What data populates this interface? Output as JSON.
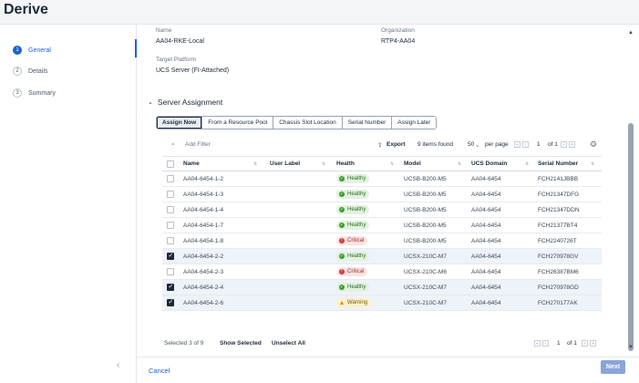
{
  "page": {
    "title": "Derive"
  },
  "steps": [
    {
      "num": "1",
      "label": "General"
    },
    {
      "num": "2",
      "label": "Details"
    },
    {
      "num": "3",
      "label": "Summary"
    }
  ],
  "general": {
    "name_label": "Name",
    "name_value": "AA04-RKE-Local",
    "org_label": "Organization",
    "org_value": "RTP4-AA04",
    "platform_label": "Target Platform",
    "platform_value": "UCS Server (FI-Attached)"
  },
  "section": {
    "title": "Server Assignment"
  },
  "tabs": [
    "Assign Now",
    "From a Resource Pool",
    "Chassis Slot Location",
    "Serial Number",
    "Assign Later"
  ],
  "toolbar": {
    "filter_placeholder": "Add Filter",
    "export_label": "Export",
    "items_found": "9 items found",
    "page_size": "50",
    "per_page": "per page",
    "page": "1",
    "of_pages": "of 1"
  },
  "table": {
    "columns": [
      "Name",
      "User Label",
      "Health",
      "Model",
      "UCS Domain",
      "Serial Number"
    ],
    "rows": [
      {
        "selected": false,
        "name": "AA04-6454-1-2",
        "health": "Healthy",
        "model": "UCSB-B200-M5",
        "domain": "AA04-6454",
        "serial": "FCH2141JBBB"
      },
      {
        "selected": false,
        "name": "AA04-6454-1-3",
        "health": "Healthy",
        "model": "UCSB-B200-M5",
        "domain": "AA04-6454",
        "serial": "FCH21347DFG"
      },
      {
        "selected": false,
        "name": "AA04-6454-1-4",
        "health": "Healthy",
        "model": "UCSB-B200-M5",
        "domain": "AA04-6454",
        "serial": "FCH21347DDN"
      },
      {
        "selected": false,
        "name": "AA04-6454-1-7",
        "health": "Healthy",
        "model": "UCSB-B200-M5",
        "domain": "AA04-6454",
        "serial": "FCH21377BT4"
      },
      {
        "selected": false,
        "name": "AA04-6454-1-8",
        "health": "Critical",
        "model": "UCSB-B200-M5",
        "domain": "AA04-6454",
        "serial": "FCH2240726T"
      },
      {
        "selected": true,
        "name": "AA04-6454-2-2",
        "health": "Healthy",
        "model": "UCSX-210C-M7",
        "domain": "AA04-6454",
        "serial": "FCH270978GV"
      },
      {
        "selected": false,
        "name": "AA04-6454-2-3",
        "health": "Critical",
        "model": "UCSX-210C-M6",
        "domain": "AA04-6454",
        "serial": "FCH26387BM6"
      },
      {
        "selected": true,
        "name": "AA04-6454-2-4",
        "health": "Healthy",
        "model": "UCSX-210C-M7",
        "domain": "AA04-6454",
        "serial": "FCH270978GD"
      },
      {
        "selected": true,
        "name": "AA04-6454-2-6",
        "health": "Warning",
        "model": "UCSX-210C-M7",
        "domain": "AA04-6454",
        "serial": "FCH270177AK"
      }
    ]
  },
  "footer": {
    "selected_text": "Selected 3 of 9",
    "show_selected": "Show Selected",
    "unselect_all": "Unselect All",
    "page": "1",
    "of_pages": "of 1"
  },
  "actions": {
    "cancel": "Cancel",
    "next": "Next"
  },
  "colors": {
    "accent": "#1d63c9",
    "healthy": "#3f9a35",
    "critical": "#cf3b3b",
    "warning": "#d39a00"
  }
}
